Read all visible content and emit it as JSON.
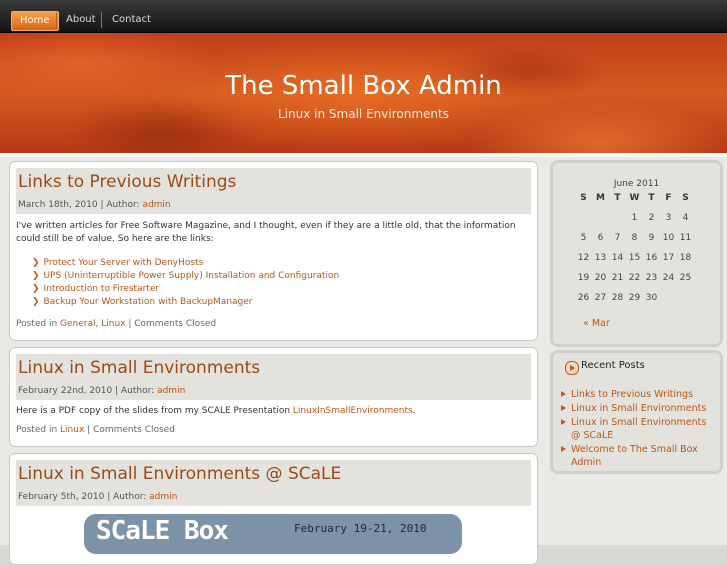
{
  "nav": {
    "items": [
      {
        "label": "Home",
        "active": true
      },
      {
        "label": "About",
        "active": false
      },
      {
        "label": "Contact",
        "active": false
      }
    ]
  },
  "site": {
    "title": "The Small Box Admin",
    "tagline": "Linux in Small Environments"
  },
  "posts": [
    {
      "title": "Links to Previous Writings",
      "date": "March 18th, 2010",
      "author_prefix": "| Author:",
      "author": "admin",
      "body": "I've written articles for Free Software Magazine, and I thought, even if they are a little old, that the information could still be of value. So here are the links:",
      "links": [
        "Protect Your Server with DenyHosts",
        "UPS (Uninterruptible Power Supply) Installation and Configuration",
        "Introduction to Firestarter",
        "Backup Your Workstation with BackupManager"
      ],
      "posted_in": "Posted in",
      "categories": [
        "General",
        "Linux"
      ],
      "comments": "| Comments Closed"
    },
    {
      "title": "Linux in Small Environments",
      "date": "February 22nd, 2010",
      "author_prefix": "| Author:",
      "author": "admin",
      "body": "Here is a PDF copy of the slides from my SCALE Presentation",
      "body_link": "LinuxInSmallEnvironments",
      "posted_in": "Posted in",
      "categories": [
        "Linux"
      ],
      "comments": "| Comments Closed"
    },
    {
      "title": "Linux in Small Environments @ SCaLE",
      "date": "February 5th, 2010",
      "author_prefix": "| Author:",
      "author": "admin",
      "image_logo": "SCaLE Box",
      "image_date": "February 19-21, 2010"
    }
  ],
  "calendar": {
    "month": "June 2011",
    "days": [
      "S",
      "M",
      "T",
      "W",
      "T",
      "F",
      "S"
    ],
    "weeks": [
      [
        "",
        "",
        "",
        "1",
        "2",
        "3",
        "4"
      ],
      [
        "5",
        "6",
        "7",
        "8",
        "9",
        "10",
        "11"
      ],
      [
        "12",
        "13",
        "14",
        "15",
        "16",
        "17",
        "18"
      ],
      [
        "19",
        "20",
        "21",
        "22",
        "23",
        "24",
        "25"
      ],
      [
        "26",
        "27",
        "28",
        "29",
        "30",
        "",
        ""
      ]
    ],
    "prev": "« Mar"
  },
  "recent": {
    "title": "Recent Posts",
    "items": [
      "Links to Previous Writings",
      "Linux in Small Environments",
      "Linux in Small Environments @ SCaLE",
      "Welcome to The Small Box Admin"
    ]
  },
  "colors": {
    "accent": "#b85718",
    "title": "#9b4a14",
    "banner": "#c8481a"
  }
}
